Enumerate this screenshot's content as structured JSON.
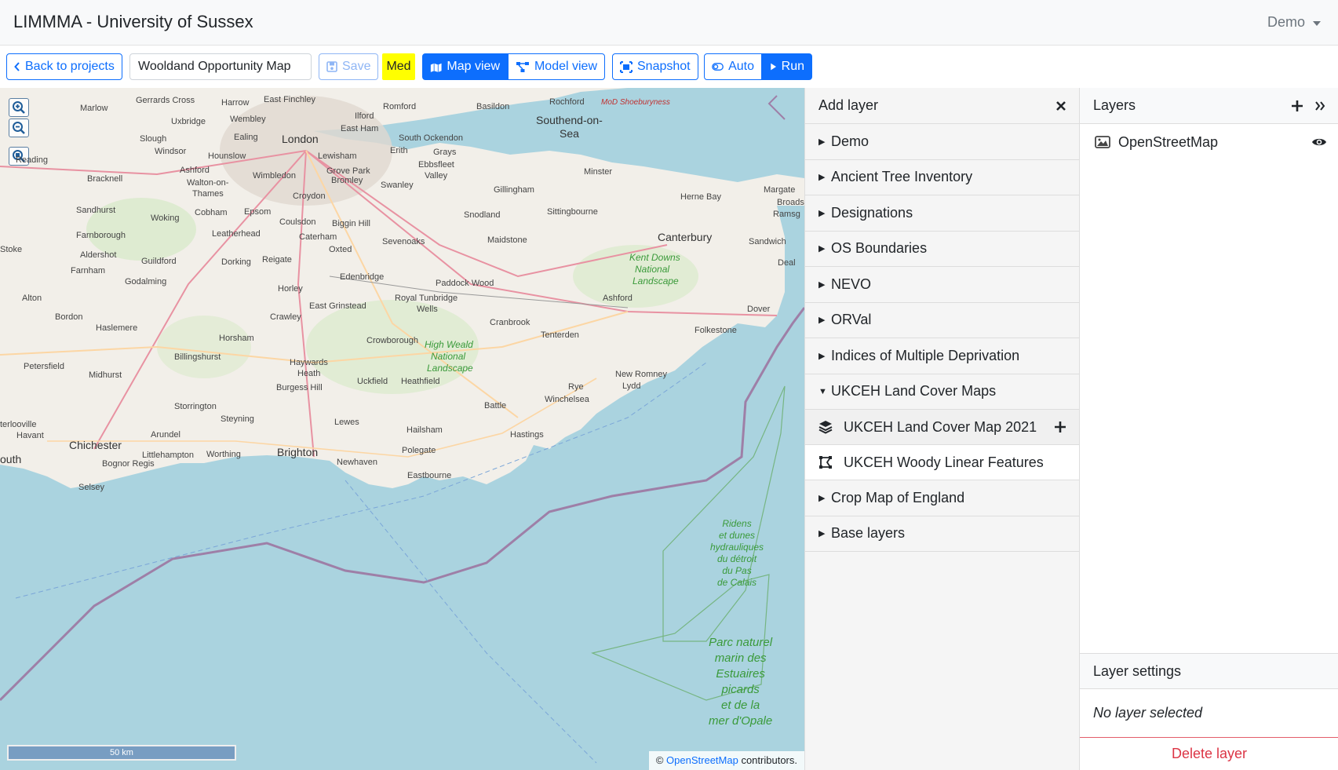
{
  "app": {
    "title": "LIMMMA - University of Sussex",
    "user": "Demo"
  },
  "toolbar": {
    "back_label": "Back to projects",
    "project_name": "Wooldand Opportunity Map",
    "save_label": "Save",
    "med_label": "Med",
    "map_view_label": "Map view",
    "model_view_label": "Model view",
    "snapshot_label": "Snapshot",
    "auto_label": "Auto",
    "run_label": "Run"
  },
  "map": {
    "scale_label": "50 km",
    "attribution_prefix": "©",
    "attribution_link": "OpenStreetMap",
    "attribution_suffix": "contributors.",
    "labels": {
      "marlow": "Marlow",
      "gerrards_cross": "Gerrards Cross",
      "harrow": "Harrow",
      "east_finchley": "East Finchley",
      "romford": "Romford",
      "basildon": "Basildon",
      "rochford": "Rochford",
      "mod": "MoD Shoeburyness",
      "uxbridge": "Uxbridge",
      "wembley": "Wembley",
      "ilford": "Ilford",
      "east_ham": "East Ham",
      "southend": "Southend-on-",
      "sea": "Sea",
      "slough": "Slough",
      "london": "London",
      "ealing": "Ealing",
      "south_ockendon": "South Ockendon",
      "windsor": "Windsor",
      "hounslow": "Hounslow",
      "lewisham": "Lewisham",
      "erith": "Erith",
      "grays": "Grays",
      "reading": "Reading",
      "ebbsfleet": "Ebbsfleet",
      "valley": "Valley",
      "ashford_n": "Ashford",
      "grove_park": "Grove Park",
      "wimbledon": "Wimbledon",
      "minster": "Minster",
      "bracknell": "Bracknell",
      "walton": "Walton-on-",
      "thames": "Thames",
      "bromley": "Bromley",
      "swanley": "Swanley",
      "gillingham": "Gillingham",
      "herne_bay": "Herne Bay",
      "margate": "Margate",
      "broadstairs": "Broads",
      "ramsgate": "Ramsg",
      "croydon": "Croydon",
      "sandhurst": "Sandhurst",
      "cobham": "Cobham",
      "epsom": "Epsom",
      "woking": "Woking",
      "coulsdon": "Coulsdon",
      "snodland": "Snodland",
      "sittingbourne": "Sittingbourne",
      "farnborough": "Farnborough",
      "leatherhead": "Leatherhead",
      "biggin_hill": "Biggin Hill",
      "canterbury": "Canterbury",
      "sandwich": "Sandwich",
      "stoke": "Stoke",
      "aldershot": "Aldershot",
      "caterham": "Caterham",
      "sevenoaks": "Sevenoaks",
      "maidstone": "Maidstone",
      "guildford": "Guildford",
      "dorking": "Dorking",
      "reigate": "Reigate",
      "oxted": "Oxted",
      "kent_downs": "Kent Downs",
      "national": "National",
      "landscape": "Landscape",
      "deal": "Deal",
      "farnham": "Farnham",
      "edenbridge": "Edenbridge",
      "godalming": "Godalming",
      "paddock_wood": "Paddock Wood",
      "horley": "Horley",
      "alton": "Alton",
      "east_grinstead": "East Grinstead",
      "royal_tunbridge": "Royal Tunbridge",
      "wells": "Wells",
      "ashford": "Ashford",
      "dover": "Dover",
      "bordon": "Bordon",
      "haslemere": "Haslemere",
      "crawley": "Crawley",
      "cranbrook": "Cranbrook",
      "folkestone": "Folkestone",
      "horsham": "Horsham",
      "tenterden": "Tenterden",
      "crowborough": "Crowborough",
      "high_weald": "High Weald",
      "billingshurst": "Billingshurst",
      "petersfield": "Petersfield",
      "haywards": "Haywards",
      "heath": "Heath",
      "new_romney": "New Romney",
      "midhurst": "Midhurst",
      "uckfield": "Uckfield",
      "heathfield": "Heathfield",
      "lydd": "Lydd",
      "burgess_hill": "Burgess Hill",
      "rye": "Rye",
      "winchelsea": "Winchelsea",
      "storrington": "Storrington",
      "battle": "Battle",
      "steyning": "Steyning",
      "lewes": "Lewes",
      "terlooville": "terlooville",
      "havant": "Havant",
      "arundel": "Arundel",
      "hailsham": "Hailsham",
      "hastings": "Hastings",
      "chichester": "Chichester",
      "brighton": "Brighton",
      "polegate": "Polegate",
      "littlehampton": "Littlehampton",
      "worthing": "Worthing",
      "outh": "outh",
      "newhaven": "Newhaven",
      "bognor": "Bognor Regis",
      "eastbourne": "Eastbourne",
      "selsey": "Selsey",
      "ridens": "Ridens\net dunes\nhydrauliques\ndu détroit\ndu Pas\nde Calais",
      "parc": "Parc naturel\nmarin des\nEstuaires\npicards\net de la\nmer d'Opale"
    }
  },
  "add_layer": {
    "title": "Add layer",
    "items": [
      {
        "label": "Demo",
        "tri": "▶"
      },
      {
        "label": "Ancient Tree Inventory",
        "tri": "▶"
      },
      {
        "label": "Designations",
        "tri": "▶"
      },
      {
        "label": "OS Boundaries",
        "tri": "▶"
      },
      {
        "label": "NEVO",
        "tri": "▶"
      },
      {
        "label": "ORVal",
        "tri": "▶"
      },
      {
        "label": "Indices of Multiple Deprivation",
        "tri": "▶"
      },
      {
        "label": "UKCEH Land Cover Maps",
        "tri": "▼"
      }
    ],
    "sub_items": [
      {
        "label": "UKCEH Land Cover Map 2021",
        "icon": "layers-icon"
      },
      {
        "label": "UKCEH Woody Linear Features",
        "icon": "polygon-icon"
      }
    ],
    "items_after": [
      {
        "label": "Crop Map of England",
        "tri": "▶"
      },
      {
        "label": "Base layers",
        "tri": "▶"
      }
    ]
  },
  "layers": {
    "title": "Layers",
    "items": [
      {
        "label": "OpenStreetMap",
        "icon": "image-icon"
      }
    ],
    "settings_title": "Layer settings",
    "no_selection": "No layer selected",
    "delete_label": "Delete layer"
  },
  "colors": {
    "primary": "#0d6efd",
    "danger": "#dc3545",
    "highlight": "#ffff00",
    "sea": "#aad3df",
    "land": "#f2efe9"
  }
}
